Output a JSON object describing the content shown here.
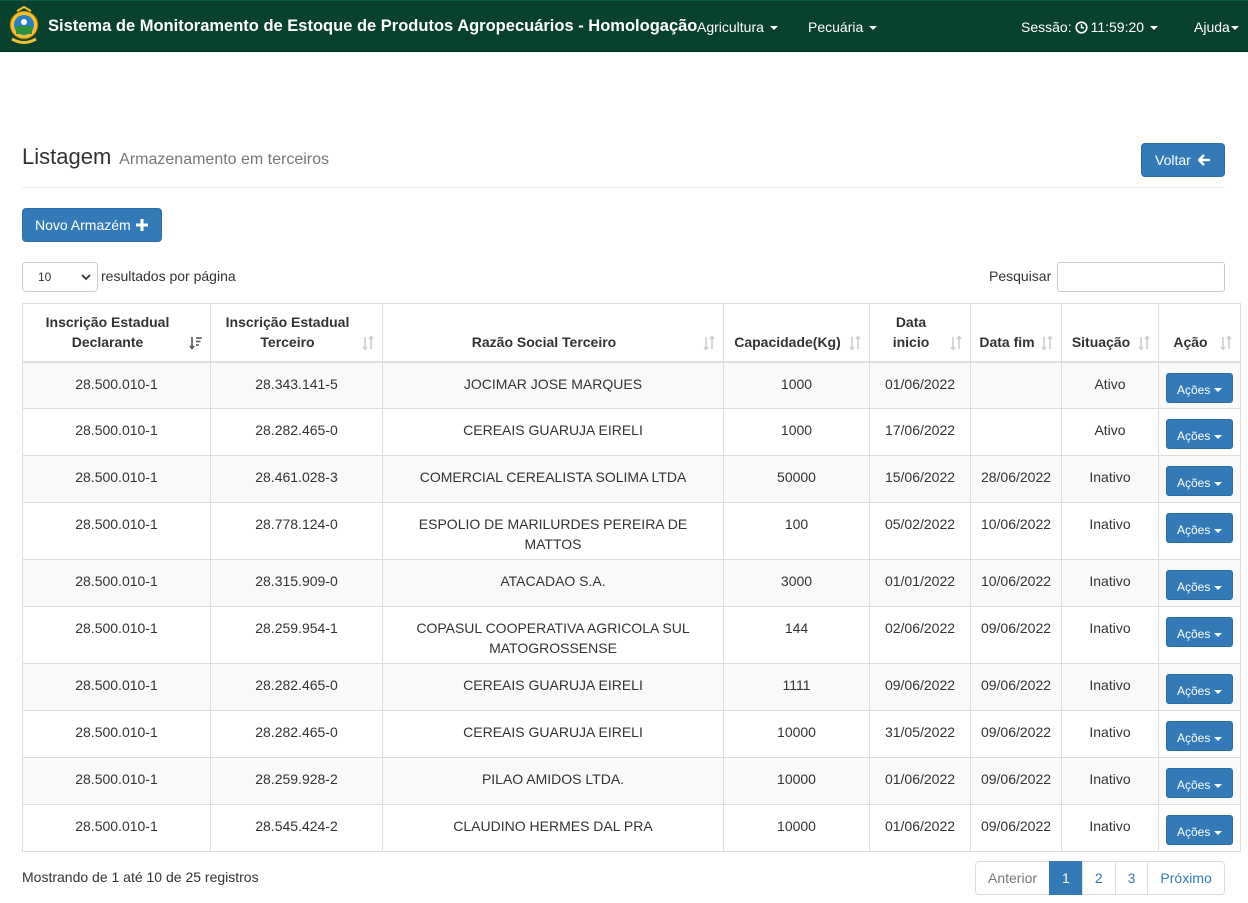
{
  "navbar": {
    "title": "Sistema de Monitoramento de Estoque de Produtos Agropecuários - Homologação",
    "menus": [
      {
        "label": "Agricultura"
      },
      {
        "label": "Pecuária"
      }
    ],
    "session_label": "Sessão:",
    "session_time": "11:59:20",
    "help_label": "Ajuda"
  },
  "header": {
    "title": "Listagem",
    "subtitle": "Armazenamento em terceiros",
    "back_label": "Voltar"
  },
  "toolbar": {
    "new_label": "Novo Armazém"
  },
  "list_controls": {
    "page_length": "10",
    "page_length_label": "resultados por página",
    "search_label": "Pesquisar",
    "search_value": ""
  },
  "table": {
    "columns": [
      {
        "label": "Inscrição Estadual Declarante",
        "sorted": true
      },
      {
        "label": "Inscrição Estadual Terceiro",
        "sorted": false
      },
      {
        "label": "Razão Social Terceiro",
        "sorted": false
      },
      {
        "label": "Capacidade(Kg)",
        "sorted": false
      },
      {
        "label": "Data inicio",
        "sorted": false
      },
      {
        "label": "Data fim",
        "sorted": false
      },
      {
        "label": "Situação",
        "sorted": false
      },
      {
        "label": "Ação",
        "sorted": false
      }
    ],
    "action_label": "Ações",
    "rows": [
      {
        "declarante": "28.500.010-1",
        "terceiro": "28.343.141-5",
        "razao": "JOCIMAR JOSE MARQUES",
        "capacidade": "1000",
        "inicio": "01/06/2022",
        "fim": "",
        "situacao": "Ativo"
      },
      {
        "declarante": "28.500.010-1",
        "terceiro": "28.282.465-0",
        "razao": "CEREAIS GUARUJA EIRELI",
        "capacidade": "1000",
        "inicio": "17/06/2022",
        "fim": "",
        "situacao": "Ativo"
      },
      {
        "declarante": "28.500.010-1",
        "terceiro": "28.461.028-3",
        "razao": "COMERCIAL CEREALISTA SOLIMA LTDA",
        "capacidade": "50000",
        "inicio": "15/06/2022",
        "fim": "28/06/2022",
        "situacao": "Inativo"
      },
      {
        "declarante": "28.500.010-1",
        "terceiro": "28.778.124-0",
        "razao": "ESPOLIO DE MARILURDES PEREIRA DE MATTOS",
        "capacidade": "100",
        "inicio": "05/02/2022",
        "fim": "10/06/2022",
        "situacao": "Inativo"
      },
      {
        "declarante": "28.500.010-1",
        "terceiro": "28.315.909-0",
        "razao": "ATACADAO S.A.",
        "capacidade": "3000",
        "inicio": "01/01/2022",
        "fim": "10/06/2022",
        "situacao": "Inativo"
      },
      {
        "declarante": "28.500.010-1",
        "terceiro": "28.259.954-1",
        "razao": "COPASUL COOPERATIVA AGRICOLA SUL MATOGROSSENSE",
        "capacidade": "144",
        "inicio": "02/06/2022",
        "fim": "09/06/2022",
        "situacao": "Inativo"
      },
      {
        "declarante": "28.500.010-1",
        "terceiro": "28.282.465-0",
        "razao": "CEREAIS GUARUJA EIRELI",
        "capacidade": "1111",
        "inicio": "09/06/2022",
        "fim": "09/06/2022",
        "situacao": "Inativo"
      },
      {
        "declarante": "28.500.010-1",
        "terceiro": "28.282.465-0",
        "razao": "CEREAIS GUARUJA EIRELI",
        "capacidade": "10000",
        "inicio": "31/05/2022",
        "fim": "09/06/2022",
        "situacao": "Inativo"
      },
      {
        "declarante": "28.500.010-1",
        "terceiro": "28.259.928-2",
        "razao": "PILAO AMIDOS LTDA.",
        "capacidade": "10000",
        "inicio": "01/06/2022",
        "fim": "09/06/2022",
        "situacao": "Inativo"
      },
      {
        "declarante": "28.500.010-1",
        "terceiro": "28.545.424-2",
        "razao": "CLAUDINO HERMES DAL PRA",
        "capacidade": "10000",
        "inicio": "01/06/2022",
        "fim": "09/06/2022",
        "situacao": "Inativo"
      }
    ]
  },
  "footer": {
    "info": "Mostrando de 1 até 10 de 25 registros",
    "prev_label": "Anterior",
    "next_label": "Próximo",
    "pages": [
      "1",
      "2",
      "3"
    ],
    "current_page": "1"
  },
  "colors": {
    "navbar_bg": "#08412e",
    "primary": "#337ab7",
    "stripe": "#f9f9f9",
    "border": "#dddddd"
  }
}
